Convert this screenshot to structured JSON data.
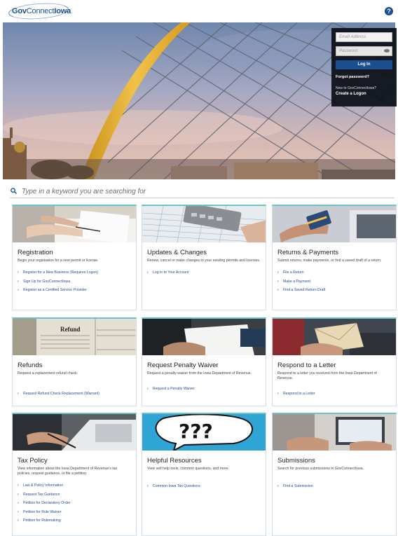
{
  "header": {
    "logo": {
      "gov": "Gov",
      "connect": "Connect",
      "iowa": "Iowa"
    },
    "help_icon": "?"
  },
  "login": {
    "email_placeholder": "Email Address",
    "password_placeholder": "Password",
    "login_label": "Log In",
    "forgot_label": "Forgot password?",
    "new_label": "New to GovConnectIowa?",
    "create_label": "Create a Logon"
  },
  "search": {
    "placeholder": "Type in a keyword you are searching for"
  },
  "cards": [
    {
      "title": "Registration",
      "desc": "Begin your registration for a new permit or license.",
      "links": [
        "Register for a New Business (Requires Logon)",
        "Sign Up for GovConnectIowa",
        "Register as a Certified Service Provider"
      ]
    },
    {
      "title": "Updates & Changes",
      "desc": "Renew, cancel or make changes to your existing permits and licenses.",
      "links": [
        "Log in to Your Account"
      ]
    },
    {
      "title": "Returns & Payments",
      "desc": "Submit returns, make payments, or find a saved draft of a return.",
      "links": [
        "File a Return",
        "Make a Payment",
        "Find a Saved Return Draft"
      ]
    },
    {
      "title": "Refunds",
      "desc": "Request a replacement refund check.",
      "links": [
        "Request Refund Check Replacement (Warrant)"
      ]
    },
    {
      "title": "Request Penalty Waiver",
      "desc": "Request a penalty waiver from the Iowa Department of Revenue.",
      "links": [
        "Request a Penalty Waiver"
      ]
    },
    {
      "title": "Respond to a Letter",
      "desc": "Respond to a letter you received from the Iowa Department of Revenue.",
      "links": [
        "Respond to a Letter"
      ]
    },
    {
      "title": "Tax Policy",
      "desc": "View information about the Iowa Department of Revenue's tax policies, request guidance, or file a petition.",
      "links": [
        "Law & Policy Information",
        "Request Tax Guidance",
        "Petition for Declaratory Order",
        "Petition for Rule Waiver",
        "Petition for Rulemaking"
      ]
    },
    {
      "title": "Helpful Resources",
      "desc": "View self help tools, common questions, and more.",
      "links": [
        "Common Iowa Tax Questions"
      ]
    },
    {
      "title": "Submissions",
      "desc": "Search for previous submissions in GovConnectIowa.",
      "links": [
        "Find a Submission"
      ]
    }
  ],
  "images": {
    "refund_word": "Refund",
    "question_marks": "???"
  },
  "colors": {
    "brand": "#1b4f8f",
    "accent": "#6bc2c9"
  }
}
